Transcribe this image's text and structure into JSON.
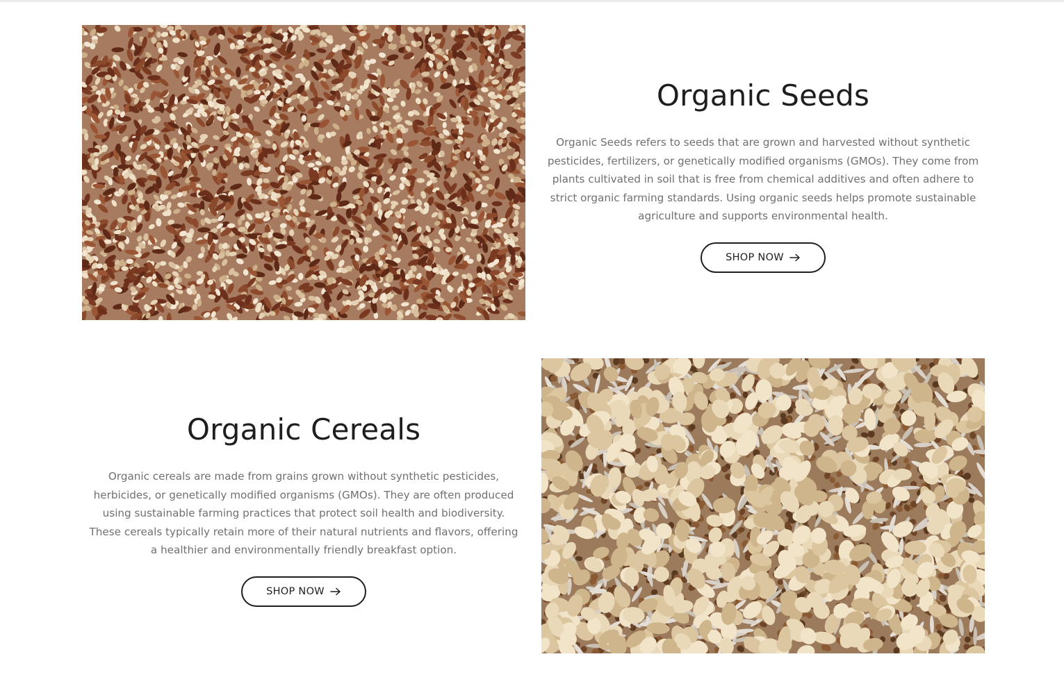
{
  "sections": [
    {
      "title": "Organic Seeds",
      "description": "Organic Seeds refers to seeds that are grown and harvested without synthetic pesticides, fertilizers, or genetically modified organisms (GMOs). They come from plants cultivated in soil that is free from chemical additives and often adhere to strict organic farming standards. Using organic seeds helps promote sustainable agriculture and supports environmental health.",
      "button_label": "SHOP NOW",
      "image": "flax-and-sesame-seeds-photo"
    },
    {
      "title": "Organic Cereals",
      "description": "Organic cereals are made from grains grown without synthetic pesticides, herbicides, or genetically modified organisms (GMOs). They are often produced using sustainable farming practices that protect soil health and biodiversity. These cereals typically retain more of their natural nutrients and flavors, offering a healthier and environmentally friendly breakfast option.",
      "button_label": "SHOP NOW",
      "image": "oats-buckwheat-rice-photo"
    }
  ],
  "icons": {
    "button_arrow": "arrow-right-icon"
  },
  "colors": {
    "heading": "#1e1e1e",
    "body_text": "#707070",
    "button_border": "#1e1e1e",
    "background": "#ffffff"
  }
}
